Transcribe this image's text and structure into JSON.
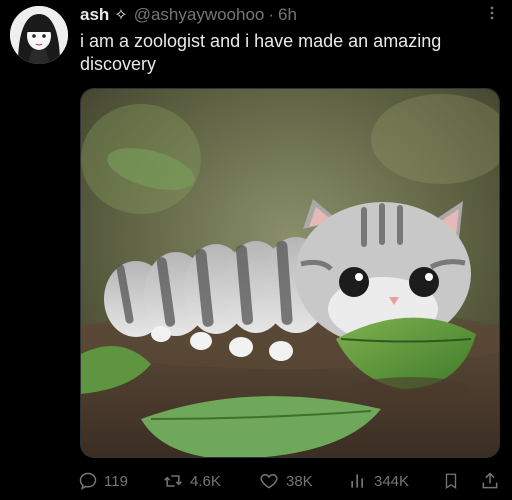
{
  "post": {
    "display_name": "ash",
    "verified_glyph": "✧",
    "handle": "@ashyaywoohoo",
    "separator": "·",
    "time": "6h",
    "text": "i am a zoologist and i have made an amazing discovery",
    "media_description_icon": "photo-kitten-caterpillar"
  },
  "actions": {
    "replies": "119",
    "reposts": "4.6K",
    "likes": "38K",
    "views": "344K"
  },
  "icons": {
    "reply": "reply-icon",
    "repost": "repost-icon",
    "like": "heart-icon",
    "views": "views-icon",
    "bookmark": "bookmark-icon",
    "share": "share-icon",
    "more": "more-icon"
  },
  "colors": {
    "background": "#000000",
    "primary_text": "#e7e9ea",
    "secondary_text": "#71767b"
  }
}
